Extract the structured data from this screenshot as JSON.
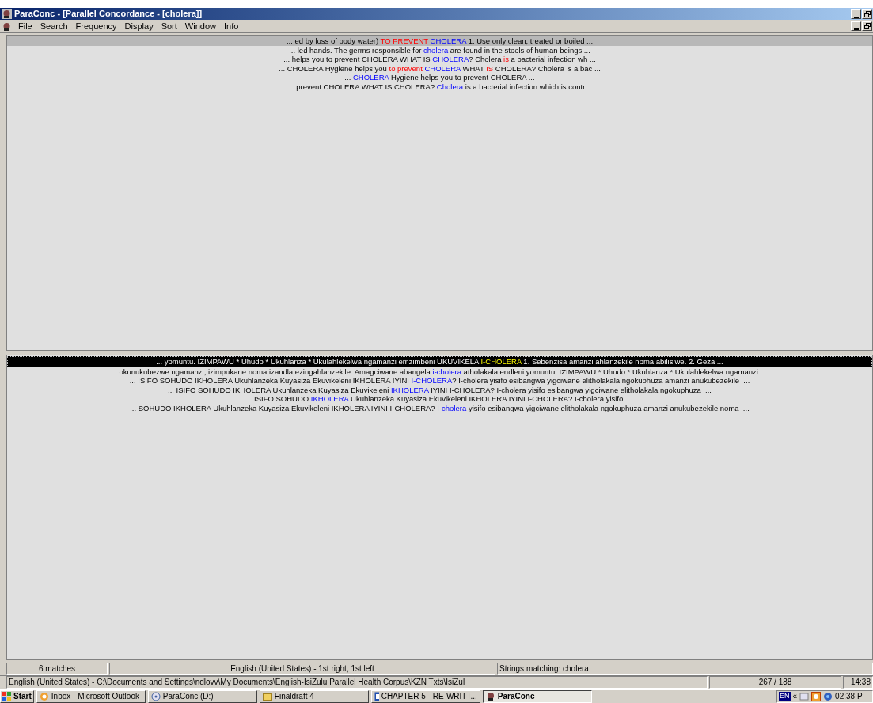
{
  "window": {
    "title": "ParaConc - [Parallel Concordance - [cholera]]"
  },
  "menu": [
    "File",
    "Search",
    "Frequency",
    "Display",
    "Sort",
    "Window",
    "Info"
  ],
  "source_pane": {
    "lines": [
      {
        "selected": true,
        "segments": [
          {
            "text": "... ed by loss of body water) ",
            "kind": "plain"
          },
          {
            "text": "TO PREVENT ",
            "kind": "collocate"
          },
          {
            "text": "CHOLERA",
            "kind": "hit"
          },
          {
            "text": " 1. Use only clean, treated or boiled ...",
            "kind": "plain"
          }
        ]
      },
      {
        "selected": false,
        "segments": [
          {
            "text": "... led hands. The germs responsible for ",
            "kind": "plain"
          },
          {
            "text": "cholera",
            "kind": "hit"
          },
          {
            "text": " are found in the stools of human beings ...",
            "kind": "plain"
          }
        ]
      },
      {
        "selected": false,
        "segments": [
          {
            "text": "... helps you to prevent CHOLERA WHAT IS ",
            "kind": "plain"
          },
          {
            "text": "CHOLERA",
            "kind": "hit"
          },
          {
            "text": "? Cholera ",
            "kind": "plain"
          },
          {
            "text": "is",
            "kind": "collocate"
          },
          {
            "text": " a bacterial infection wh ...",
            "kind": "plain"
          }
        ]
      },
      {
        "selected": false,
        "segments": [
          {
            "text": "... CHOLERA Hygiene helps you ",
            "kind": "plain"
          },
          {
            "text": "to prevent ",
            "kind": "collocate"
          },
          {
            "text": "CHOLERA",
            "kind": "hit"
          },
          {
            "text": " WHAT ",
            "kind": "plain"
          },
          {
            "text": "IS",
            "kind": "collocate"
          },
          {
            "text": " CHOLERA? Cholera is a bac ...",
            "kind": "plain"
          }
        ]
      },
      {
        "selected": false,
        "segments": [
          {
            "text": "... ",
            "kind": "plain"
          },
          {
            "text": "CHOLERA",
            "kind": "hit"
          },
          {
            "text": " Hygiene helps you to prevent CHOLERA ...",
            "kind": "plain"
          }
        ]
      },
      {
        "selected": false,
        "segments": [
          {
            "text": "...  prevent CHOLERA WHAT IS CHOLERA? ",
            "kind": "plain"
          },
          {
            "text": "Cholera",
            "kind": "hit"
          },
          {
            "text": " is a bacterial infection which is contr ...",
            "kind": "plain"
          }
        ]
      }
    ]
  },
  "target_pane": {
    "lines": [
      {
        "selected": true,
        "segments": [
          {
            "text": "... yomuntu. IZIMPAWU * Uhudo * Ukuhlanza * Ukulahlekelwa ngamanzi emzimbeni UKUVIKELA ",
            "kind": "plain"
          },
          {
            "text": "I-CHOLERA",
            "kind": "hit"
          },
          {
            "text": " 1. Sebenzisa amanzi ahlanzekile noma abilisiwe. 2. Geza ...",
            "kind": "plain"
          }
        ]
      },
      {
        "selected": false,
        "segments": [
          {
            "text": "... okunukubezwe ngamanzi, izimpukane noma izandla ezingahlanzekile. Amagciwane abangela ",
            "kind": "plain"
          },
          {
            "text": "i-cholera",
            "kind": "hit"
          },
          {
            "text": " atholakala endleni yomuntu. IZIMPAWU * Uhudo * Ukuhlanza * Ukulahlekelwa ngamanzi  ...",
            "kind": "plain"
          }
        ]
      },
      {
        "selected": false,
        "segments": [
          {
            "text": "... ISIFO SOHUDO IKHOLERA Ukuhlanzeka Kuyasiza Ekuvikeleni IKHOLERA IYINI ",
            "kind": "plain"
          },
          {
            "text": "I-CHOLERA",
            "kind": "hit"
          },
          {
            "text": "? I-cholera yisifo esibangwa yigciwane elitholakala ngokuphuza amanzi anukubezekile  ...",
            "kind": "plain"
          }
        ]
      },
      {
        "selected": false,
        "segments": [
          {
            "text": "... ISIFO SOHUDO IKHOLERA Ukuhlanzeka Kuyasiza Ekuvikeleni ",
            "kind": "plain"
          },
          {
            "text": "IKHOLERA",
            "kind": "hit"
          },
          {
            "text": " IYINI I-CHOLERA? I-cholera yisifo esibangwa yigciwane elitholakala ngokuphuza  ...",
            "kind": "plain"
          }
        ]
      },
      {
        "selected": false,
        "segments": [
          {
            "text": "... ISIFO SOHUDO ",
            "kind": "plain"
          },
          {
            "text": "IKHOLERA",
            "kind": "hit"
          },
          {
            "text": " Ukuhlanzeka Kuyasiza Ekuvikeleni IKHOLERA IYINI I-CHOLERA? I-cholera yisifo  ...",
            "kind": "plain"
          }
        ]
      },
      {
        "selected": false,
        "segments": [
          {
            "text": "... SOHUDO IKHOLERA Ukuhlanzeka Kuyasiza Ekuvikeleni IKHOLERA IYINI I-CHOLERA? ",
            "kind": "plain"
          },
          {
            "text": "I-cholera",
            "kind": "hit"
          },
          {
            "text": " yisifo esibangwa yigciwane elitholakala ngokuphuza amanzi anukubezekile noma  ...",
            "kind": "plain"
          }
        ]
      }
    ]
  },
  "status_bar": {
    "matches": "6 matches",
    "alignment": "English (United States) - 1st right, 1st left",
    "search": "Strings matching: cholera"
  },
  "path_bar": {
    "path": "English (United States) - C:\\Documents and Settings\\ndlovv\\My Documents\\English-IsiZulu Parallel Health Corpus\\KZN Txts\\IsiZul",
    "position": "267 / 188",
    "time": "14:38"
  },
  "taskbar": {
    "start": "Start",
    "tasks": [
      {
        "label": "Inbox - Microsoft Outlook",
        "kind": "mail",
        "selected": false
      },
      {
        "label": "ParaConc (D:)",
        "kind": "disc",
        "selected": false
      },
      {
        "label": "Finaldraft 4",
        "kind": "folder",
        "selected": false
      },
      {
        "label": "CHAPTER 5 - RE-WRITT...",
        "kind": "document",
        "selected": false
      },
      {
        "label": "ParaConc",
        "kind": "app",
        "selected": true
      }
    ],
    "language": "EN",
    "tray_toggle": "«",
    "clock": "02:38 P"
  }
}
